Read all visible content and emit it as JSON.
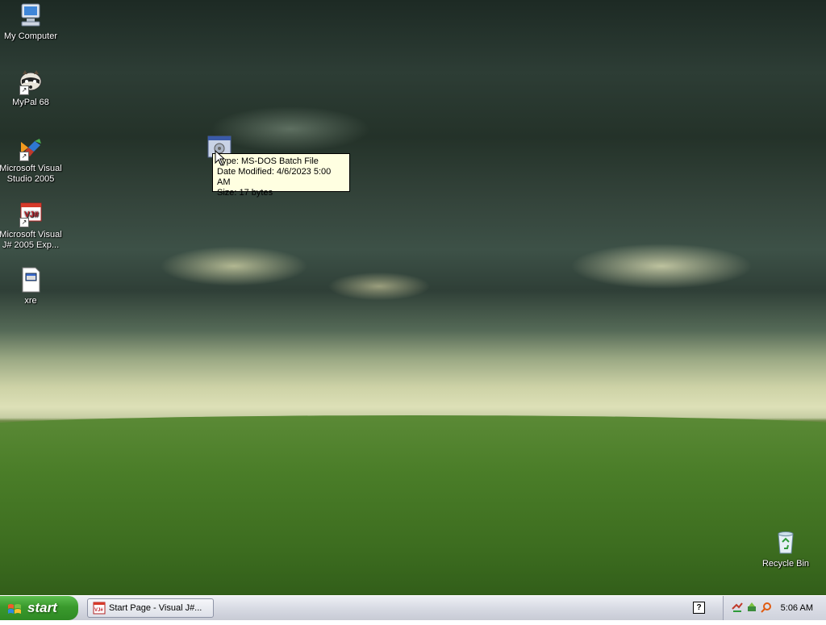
{
  "desktop": {
    "icons": [
      {
        "label": "My Computer",
        "icon": "computer-icon"
      },
      {
        "label": "MyPal 68",
        "icon": "raccoon-icon"
      },
      {
        "label": "Microsoft Visual Studio 2005",
        "icon": "visual-studio-icon"
      },
      {
        "label": "Microsoft Visual J# 2005 Exp...",
        "icon": "vjsharp-icon"
      },
      {
        "label": "xre",
        "icon": "file-icon"
      },
      {
        "label": "Recycle Bin",
        "icon": "recycle-bin-icon"
      }
    ]
  },
  "tooltip": {
    "type": "Type: MS-DOS Batch File",
    "modified": "Date Modified: 4/6/2023 5:00 AM",
    "size": "Size: 17 bytes"
  },
  "taskbar": {
    "start_label": "start",
    "task_item_label": "Start Page - Visual J#...",
    "help_label": "?",
    "clock": "5:06 AM"
  },
  "colors": {
    "taskbar": "#d8dbe4",
    "start_button": "#3a9a2d",
    "tooltip_bg": "#ffffe1"
  }
}
